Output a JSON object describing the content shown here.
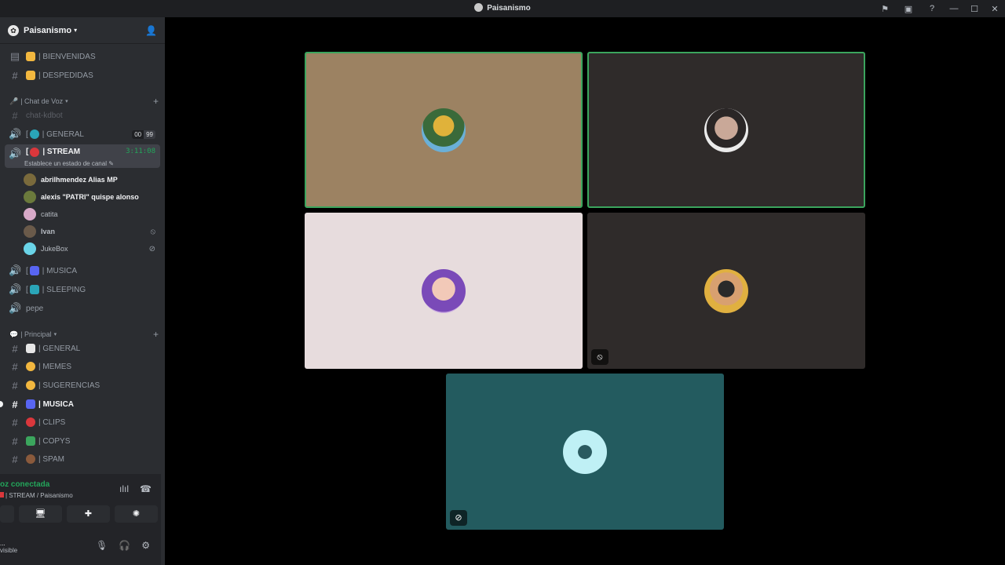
{
  "window": {
    "title": "Paisanismo"
  },
  "sidebar": {
    "server_name": "Paisanismo",
    "channels_top": [
      {
        "emoji_color": "#f2b73f",
        "label": "| BIENVENIDAS"
      },
      {
        "emoji_color": "#f2b73f",
        "label": "| DESPEDIDAS"
      }
    ],
    "voice_category": "| Chat de Voz",
    "voice_channels": {
      "chat_kdbot": "chat-kdbot",
      "general": "| GENERAL",
      "general_count_a": "00",
      "general_count_b": "99",
      "stream": "| STREAM",
      "stream_timer": "3:11:08",
      "stream_status": "Establece un estado de canal",
      "musica": "| MUSICA",
      "sleeping": "| SLEEPING",
      "pepe": "pepe"
    },
    "members": [
      {
        "name": "abrilhmendez Alias MP",
        "color": "#7a6a3c"
      },
      {
        "name": "alexis \"PATRI\" quispe alonso",
        "color": "#6b7a3c"
      },
      {
        "name": "catita",
        "color": "#d7a9c8"
      },
      {
        "name": "Ivan",
        "color": "#6a5a4a"
      },
      {
        "name": "JukeBox",
        "color": "#6ad4e8"
      }
    ],
    "principal_category": "| Principal",
    "text_channels": [
      {
        "label": "| GENERAL",
        "emoji_color": "#e6e6e6"
      },
      {
        "label": "| MEMES",
        "emoji_color": "#f2b73f"
      },
      {
        "label": "| SUGERENCIAS",
        "emoji_color": "#f2b73f"
      },
      {
        "label": "| MUSICA",
        "emoji_color": "#5865f2"
      },
      {
        "label": "| CLIPS",
        "emoji_color": "#da373c"
      },
      {
        "label": "| COPYS",
        "emoji_color": "#3ba55d"
      },
      {
        "label": "| SPAM",
        "emoji_color": "#8a5a3c"
      }
    ]
  },
  "voice_panel": {
    "status": "oz conectada",
    "subtitle": "| STREAM / Paisanismo"
  },
  "user_panel": {
    "name": "...",
    "status": "visible"
  },
  "tiles": [
    {
      "bg": "#9c8262",
      "avatar_color": "#c9a24a",
      "speaking": true
    },
    {
      "bg": "#2f2b2a",
      "avatar_color": "#5a4a40",
      "speaking": true
    },
    {
      "bg": "#e7dcdd",
      "avatar_color": "#9c7fc7",
      "speaking": false
    },
    {
      "bg": "#2f2b2a",
      "avatar_color": "#c28a3c",
      "speaking": false,
      "muted": true
    },
    {
      "bg": "#235b5f",
      "avatar_color": "#bff0f5",
      "speaking": false,
      "deafened": true
    }
  ]
}
